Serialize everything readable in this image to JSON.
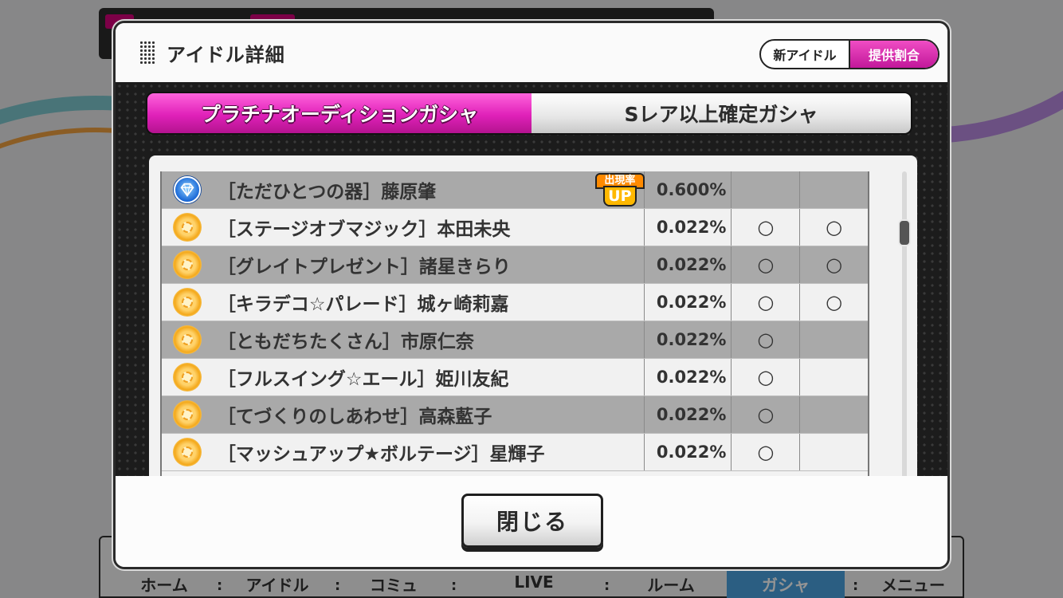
{
  "background": {
    "nav": {
      "items": [
        {
          "label": "ホーム",
          "active": false
        },
        {
          "label": "アイドル",
          "active": false
        },
        {
          "label": "コミュ",
          "active": false
        },
        {
          "label": "LIVE",
          "active": false
        },
        {
          "label": "ルーム",
          "active": false
        },
        {
          "label": "ガシャ",
          "active": true
        },
        {
          "label": "メニュー",
          "active": false
        }
      ]
    }
  },
  "dialog": {
    "title": "アイドル詳細",
    "toggle": {
      "new_idol_label": "新アイドル",
      "rates_label": "提供割合",
      "active": "rates"
    },
    "tabs": [
      {
        "label": "プラチナオーディションガシャ",
        "active": true
      },
      {
        "label": "Sレア以上確定ガシャ",
        "active": false
      }
    ],
    "rows": [
      {
        "rarity": "ssr",
        "icon": "diamond-icon",
        "name": "［ただひとつの器］藤原肇",
        "badge": {
          "top": "出現率",
          "bottom": "UP"
        },
        "rate": "0.600%",
        "mark1": "",
        "mark2": ""
      },
      {
        "rarity": "sr",
        "icon": "sun-icon",
        "name": "［ステージオブマジック］本田未央",
        "rate": "0.022%",
        "mark1": "○",
        "mark2": "○"
      },
      {
        "rarity": "sr",
        "icon": "sun-icon",
        "name": "［グレイトプレゼント］諸星きらり",
        "rate": "0.022%",
        "mark1": "○",
        "mark2": "○"
      },
      {
        "rarity": "sr",
        "icon": "sun-icon",
        "name": "［キラデコ☆パレード］城ヶ崎莉嘉",
        "rate": "0.022%",
        "mark1": "○",
        "mark2": "○"
      },
      {
        "rarity": "sr",
        "icon": "sun-icon",
        "name": "［ともだちたくさん］市原仁奈",
        "rate": "0.022%",
        "mark1": "○",
        "mark2": ""
      },
      {
        "rarity": "sr",
        "icon": "sun-icon",
        "name": "［フルスイング☆エール］姫川友紀",
        "rate": "0.022%",
        "mark1": "○",
        "mark2": ""
      },
      {
        "rarity": "sr",
        "icon": "sun-icon",
        "name": "［てづくりのしあわせ］高森藍子",
        "rate": "0.022%",
        "mark1": "○",
        "mark2": ""
      },
      {
        "rarity": "sr",
        "icon": "sun-icon",
        "name": "［マッシュアップ★ボルテージ］星輝子",
        "rate": "0.022%",
        "mark1": "○",
        "mark2": ""
      }
    ],
    "close_label": "閉じる"
  },
  "colors": {
    "accent_pink": "#e021b9",
    "ssr_blue": "#1967d6",
    "sr_gold": "#f4a91c"
  }
}
